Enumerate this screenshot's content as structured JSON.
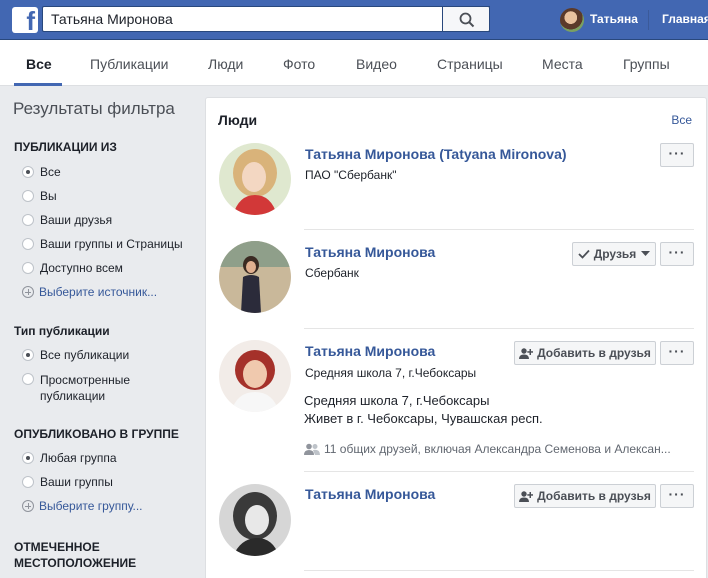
{
  "topbar": {
    "logo": "f",
    "search_value": "Татьяна Миронова",
    "user_name": "Татьяна",
    "home_label": "Главная"
  },
  "tabs": [
    "Все",
    "Публикации",
    "Люди",
    "Фото",
    "Видео",
    "Страницы",
    "Места",
    "Группы"
  ],
  "sidebar": {
    "title": "Результаты фильтра",
    "sections": [
      {
        "heading": "ПУБЛИКАЦИИ ИЗ",
        "options": [
          "Все",
          "Вы",
          "Ваши друзья",
          "Ваши группы и Страницы",
          "Доступно всем"
        ],
        "selected": 0,
        "choose_link": "Выберите источник..."
      },
      {
        "heading": "Тип публикации",
        "options": [
          "Все публикации",
          "Просмотренные публикации"
        ],
        "selected": 0
      },
      {
        "heading": "ОПУБЛИКОВАНО В ГРУППЕ",
        "options": [
          "Любая группа",
          "Ваши группы"
        ],
        "selected": 0,
        "choose_link": "Выберите группу..."
      },
      {
        "heading": "ОТМЕЧЕННОЕ МЕСТОПОЛОЖЕНИЕ"
      }
    ]
  },
  "people": {
    "title": "Люди",
    "see_all": "Все",
    "results": [
      {
        "name": "Татьяна Миронова (Tatyana Mironova)",
        "subtitle": "ПАО \"Сбербанк\"",
        "more": "···"
      },
      {
        "name": "Татьяна Миронова",
        "subtitle": "Сбербанк",
        "friend_button": "Друзья",
        "more": "···"
      },
      {
        "name": "Татьяна Миронова",
        "subtitle": "Средняя школа 7, г.Чебоксары",
        "details": [
          "Средняя школа 7, г.Чебоксары",
          "Живет в г. Чебоксары, Чувашская респ."
        ],
        "mutual": "11 общих друзей, включая Александра Семенова и Алексан...",
        "add_button": "Добавить в друзья",
        "more": "···"
      },
      {
        "name": "Татьяна Миронова",
        "add_button": "Добавить в друзья",
        "more": "···"
      }
    ]
  }
}
